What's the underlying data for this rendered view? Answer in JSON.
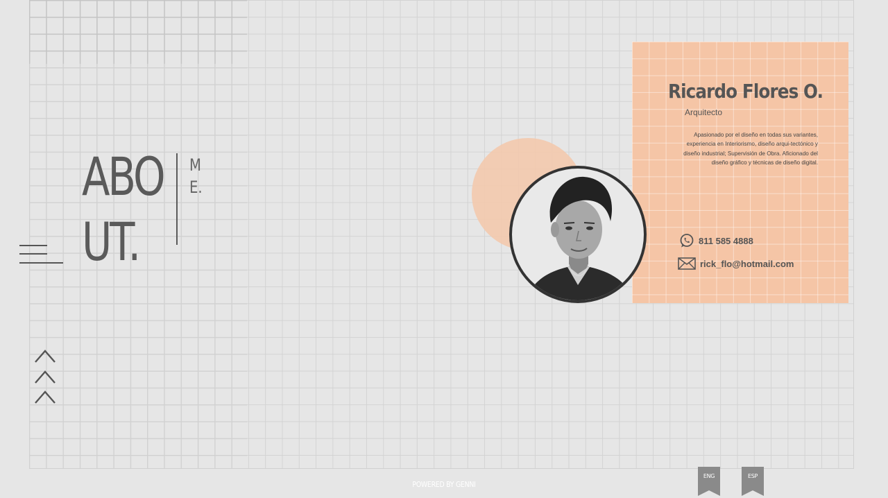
{
  "hero": {
    "title_line1": "ABO",
    "title_line2": "UT.",
    "side_letter1": "M",
    "side_letter2": "E."
  },
  "profile": {
    "name": "Ricardo Flores O.",
    "role": "Arquitecto",
    "bio": "Apasionado por el diseño en todas sus variantes, experiencia en Interiorismo, diseño arqui-tectónico y diseño industrial; Supervisión de Obra. Aficionado del diseño gráfico y técnicas de diseño digital.",
    "phone": "811 585 4888",
    "email": "rick_flo@hotmail.com"
  },
  "footer": {
    "powered_by": "POWERED BY GENNI"
  },
  "languages": {
    "eng": "ENG",
    "esp": "ESP"
  },
  "colors": {
    "background": "#e6e6e6",
    "accent_peach": "#f5c5a6",
    "text_dark": "#555555",
    "ribbon": "#8a8a8a"
  },
  "icons": {
    "menu": "hamburger-icon",
    "scroll_up": "chevron-up-icon",
    "phone": "whatsapp-icon",
    "email": "envelope-icon"
  }
}
